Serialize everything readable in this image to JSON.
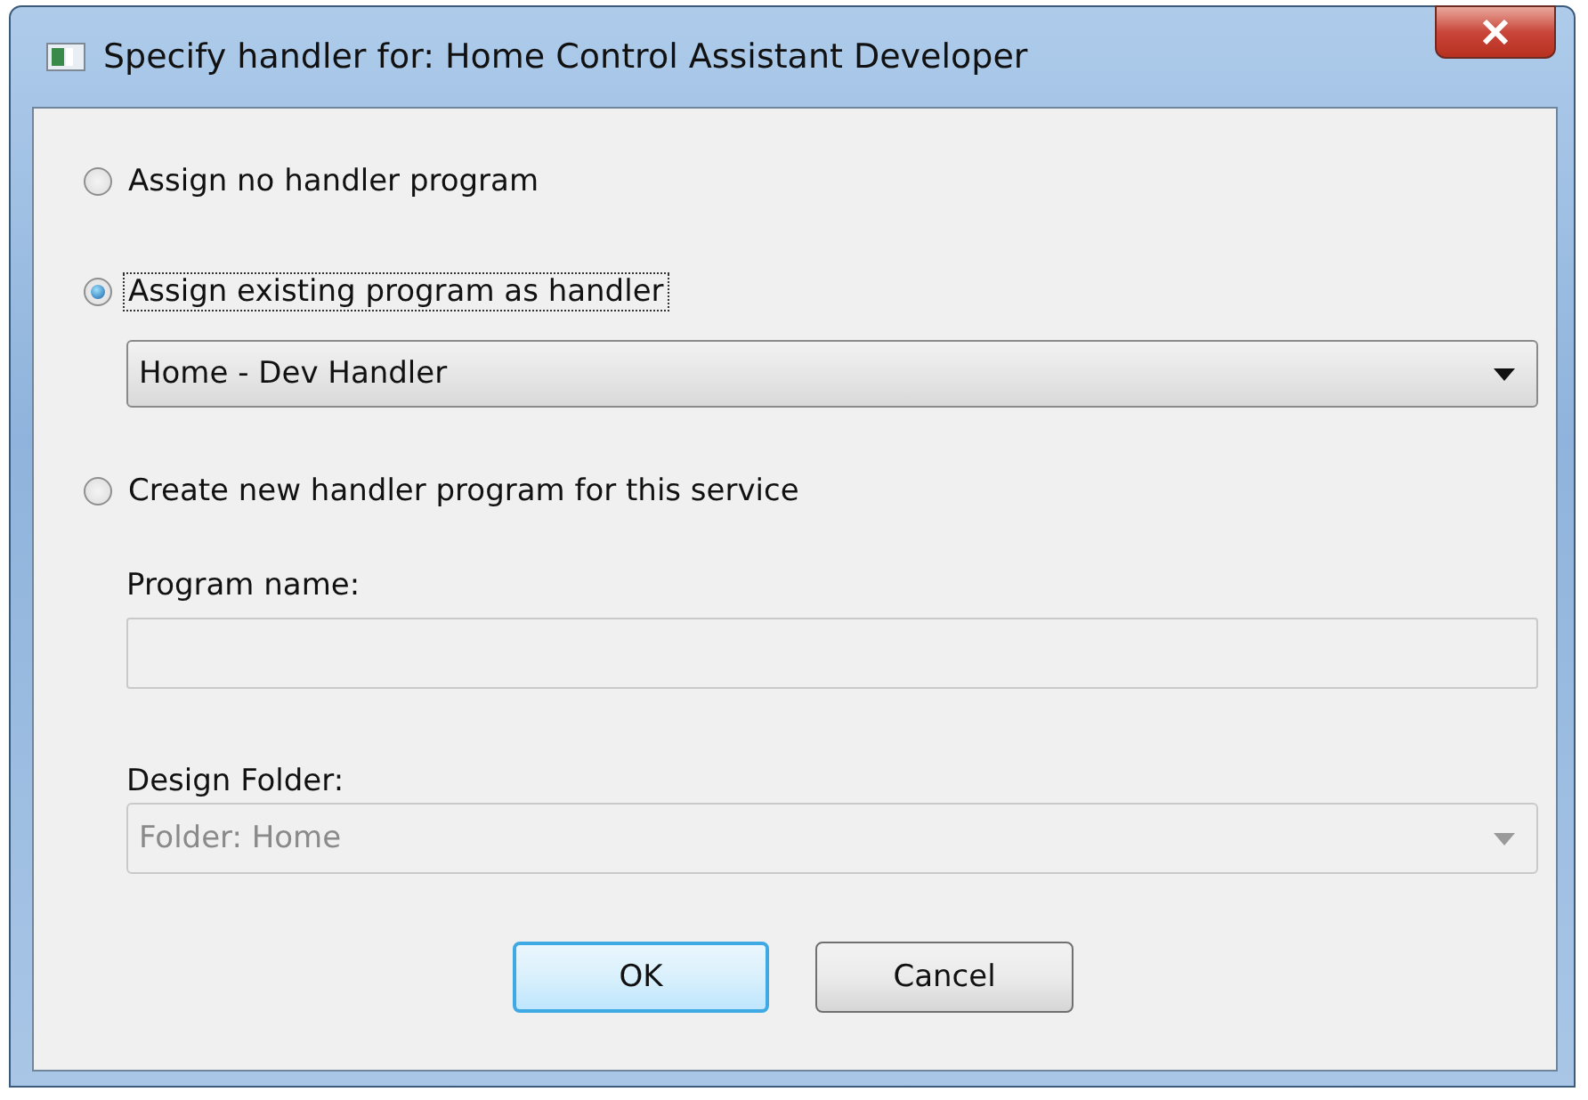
{
  "window": {
    "title": "Specify handler for: Home Control Assistant Developer"
  },
  "options": [
    {
      "kind": "radio",
      "label": "Assign no handler program",
      "selected": false,
      "focused": false
    },
    {
      "kind": "radio",
      "label": "Assign existing program as handler",
      "selected": true,
      "focused": true
    },
    {
      "kind": "dropdown",
      "value": "Home - Dev Handler",
      "disabled": false
    },
    {
      "kind": "radio",
      "label": "Create new handler program for this service",
      "selected": false,
      "focused": false
    },
    {
      "kind": "label",
      "label": "Program name:"
    },
    {
      "kind": "textfield",
      "disabled": true
    },
    {
      "kind": "label",
      "label": "Design Folder:"
    },
    {
      "kind": "dropdown",
      "value": "Folder: Home",
      "disabled": true
    }
  ],
  "buttons": [
    {
      "label": "OK",
      "default": true
    },
    {
      "label": "Cancel",
      "default": false
    }
  ]
}
